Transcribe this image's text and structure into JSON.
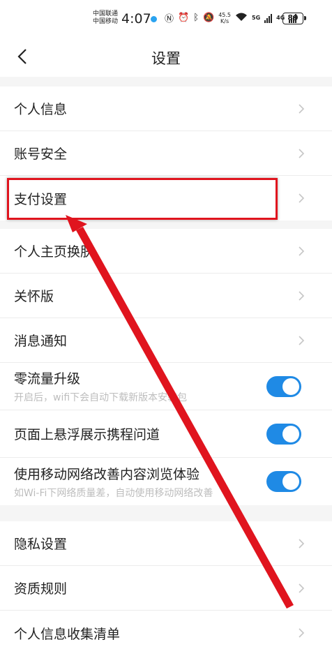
{
  "status_bar": {
    "carrier1": "中国联通",
    "carrier2": "中国移动",
    "time": "4:07",
    "net_speed_value": "45.5",
    "net_speed_unit": "K/s",
    "net_type1": "5G",
    "net_type2": "4G",
    "battery": "89"
  },
  "nav": {
    "title": "设置"
  },
  "sections": [
    {
      "items": [
        {
          "label": "个人信息"
        },
        {
          "label": "账号安全"
        },
        {
          "label": "支付设置"
        }
      ]
    },
    {
      "items": [
        {
          "label": "个人主页换肤"
        },
        {
          "label": "关怀版"
        },
        {
          "label": "消息通知"
        },
        {
          "label": "零流量升级",
          "sub": "开启后，wifi下会自动下载新版本安装包",
          "toggle": true
        },
        {
          "label": "页面上悬浮展示携程问道",
          "toggle": true
        },
        {
          "label": "使用移动网络改善内容浏览体验",
          "sub": "如Wi-Fi下网络质量差，自动使用移动网络改善",
          "toggle": true
        }
      ]
    },
    {
      "items": [
        {
          "label": "隐私设置"
        },
        {
          "label": "资质规则"
        },
        {
          "label": "个人信息收集清单"
        }
      ]
    }
  ],
  "colors": {
    "accent": "#1f8ae5",
    "annotation": "#e0141e"
  }
}
